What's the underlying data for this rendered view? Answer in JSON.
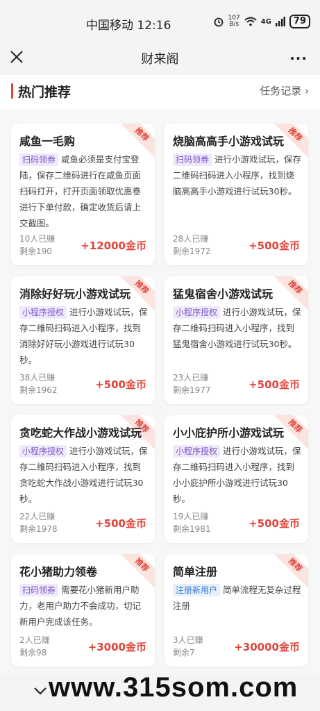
{
  "status": {
    "carrier_time": "中国移动 12:16",
    "speed_top": "107",
    "speed_bottom": "B/s",
    "network": "4G",
    "battery": "79"
  },
  "nav": {
    "title": "财来阁",
    "more": "···"
  },
  "section": {
    "title": "热门推荐",
    "record_link": "任务记录 ›"
  },
  "badge": "推荐",
  "cards": [
    {
      "title": "咸鱼一毛购",
      "tag": "扫码领券",
      "desc": "咸鱼必须是支付宝登陆，保存二维码进行在咸鱼页面扫码打开，打开页面领取优惠卷进行下单付款，确定收货后请上交截图。",
      "earned": "10人已赚",
      "remain": "剩余190",
      "reward": "+12000金币"
    },
    {
      "title": "烧脑高高手小游戏试玩",
      "tag": "扫码领券",
      "desc": "进行小游戏试玩，保存二维码扫码进入小程序，找到烧脑高高手小游戏进行试玩30秒。",
      "earned": "28人已赚",
      "remain": "剩余1972",
      "reward": "+500金币"
    },
    {
      "title": "消除好好玩小游戏试玩",
      "tag": "小程序授权",
      "desc": "进行小游戏试玩，保存二维码扫码进入小程序，找到消除好好玩小游戏进行试玩30秒。",
      "earned": "38人已赚",
      "remain": "剩余1962",
      "reward": "+500金币"
    },
    {
      "title": "猛鬼宿舍小游戏试玩",
      "tag": "小程序授权",
      "desc": "进行小游戏试玩，保存二维码扫码进入小程序，找到猛鬼宿舍小游戏进行试玩30秒。",
      "earned": "23人已赚",
      "remain": "剩余1977",
      "reward": "+500金币"
    },
    {
      "title": "贪吃蛇大作战小游戏试玩",
      "tag": "小程序授权",
      "desc": "进行小游戏试玩，保存二维码扫码进入小程序，找到贪吃蛇大作战小游戏进行试玩30秒。",
      "earned": "22人已赚",
      "remain": "剩余1978",
      "reward": "+500金币"
    },
    {
      "title": "小小庇护所小游戏试玩",
      "tag": "小程序授权",
      "desc": "进行小游戏试玩，保存二维码扫码进入小程序，找到小小庇护所小游戏进行试玩30秒。",
      "earned": "19人已赚",
      "remain": "剩余1981",
      "reward": "+500金币"
    },
    {
      "title": "花小猪助力领卷",
      "tag": "扫码领券",
      "desc": "需要花小猪新用户助力，老用户助力不会成功，切记新用户完成该任务。",
      "earned": "2人已赚",
      "remain": "剩余98",
      "reward": "+3000金币"
    },
    {
      "title": "简单注册",
      "tag": "注册新用户",
      "desc": "简单流程无复杂过程注册",
      "earned": "3人已赚",
      "remain": "剩余7",
      "reward": "+30000金币"
    }
  ],
  "watermark": "www.315som.com"
}
